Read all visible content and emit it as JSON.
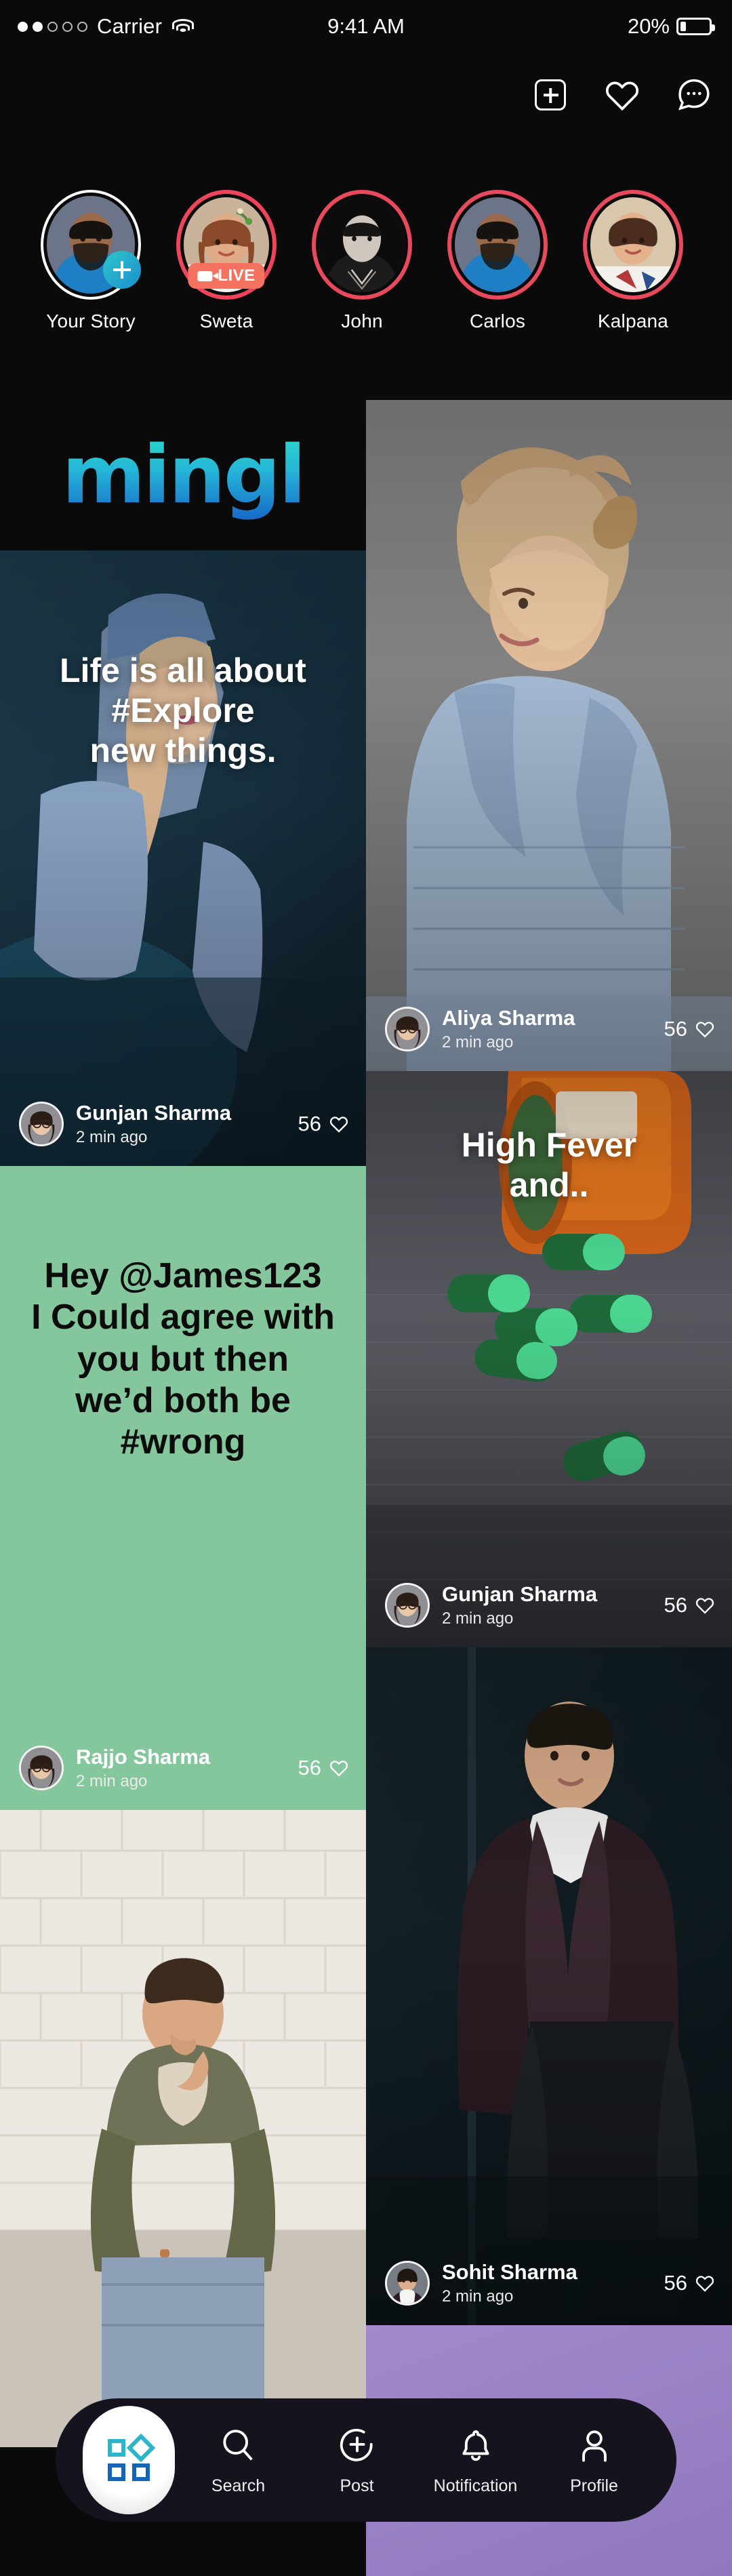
{
  "status_bar": {
    "carrier": "Carrier",
    "signal_dots_filled": 2,
    "signal_dots_total": 5,
    "wifi_icon": "wifi-icon",
    "time": "9:41 AM",
    "battery_percent": "20%",
    "battery_level": 20
  },
  "header": {
    "actions": [
      {
        "name": "add-post-button",
        "icon": "plus-box-icon",
        "label": ""
      },
      {
        "name": "activity-button",
        "icon": "heart-icon",
        "label": ""
      },
      {
        "name": "messages-button",
        "icon": "chat-bubble-dots-icon",
        "label": ""
      }
    ]
  },
  "brand": {
    "logo_text": "mingl",
    "gradient_from": "#2ae0c8",
    "gradient_to": "#1767c8"
  },
  "stories": {
    "items": [
      {
        "label": "Your Story",
        "ring": "own",
        "badge": "add",
        "live": false
      },
      {
        "label": "Sweta",
        "ring": "live",
        "badge": "live",
        "live": true,
        "live_label": "LIVE"
      },
      {
        "label": "John",
        "ring": "seen",
        "badge": "none",
        "live": false
      },
      {
        "label": "Carlos",
        "ring": "seen",
        "badge": "none",
        "live": false
      },
      {
        "label": "Kalpana",
        "ring": "seen",
        "badge": "none",
        "live": false
      }
    ]
  },
  "feed": {
    "posts": [
      {
        "id": "post-explore",
        "column": "left",
        "caption": "Life is all about\n#Explore\nnew things.",
        "caption_color": "light",
        "author": "Gunjan Sharma",
        "time": "2 min ago",
        "likes": "56",
        "theme": "photo-denim-blue"
      },
      {
        "id": "post-aliya",
        "column": "right",
        "caption": "",
        "caption_color": "light",
        "author": "Aliya Sharma",
        "time": "2 min ago",
        "likes": "56",
        "theme": "photo-grey-portrait"
      },
      {
        "id": "post-wrong",
        "column": "left",
        "caption": "Hey @James123\nI Could agree with\nyou but then\nwe’d both be\n#wrong",
        "caption_color": "dark",
        "author": "Rajjo Sharma",
        "time": "2 min ago",
        "likes": "56",
        "theme": "solid-green",
        "background_color": "#84C79C"
      },
      {
        "id": "post-fever",
        "column": "right",
        "caption": "High Fever\nand..",
        "caption_color": "light",
        "author": "Gunjan Sharma",
        "time": "2 min ago",
        "likes": "56",
        "theme": "photo-pills"
      },
      {
        "id": "post-thinker",
        "column": "left",
        "caption": "",
        "caption_color": "light",
        "author": "",
        "time": "",
        "likes": "",
        "theme": "photo-brick-man"
      },
      {
        "id": "post-sohit",
        "column": "right",
        "caption": "",
        "caption_color": "light",
        "author": "Sohit Sharma",
        "time": "2 min ago",
        "likes": "56",
        "theme": "photo-dark-suit"
      },
      {
        "id": "post-orange",
        "column": "left",
        "caption": "",
        "author": "",
        "time": "",
        "likes": "",
        "theme": "solid-orange",
        "background_color": "#F0BC80"
      },
      {
        "id": "post-purple",
        "column": "right",
        "caption": "",
        "author": "",
        "time": "",
        "likes": "",
        "theme": "solid-purple",
        "background_color": "#9B80C4"
      }
    ]
  },
  "bottom_nav": {
    "items": [
      {
        "name": "nav-home",
        "label": "",
        "icon": "grid-icon",
        "active": true
      },
      {
        "name": "nav-search",
        "label": "Search",
        "icon": "search-icon",
        "active": false
      },
      {
        "name": "nav-post",
        "label": "Post",
        "icon": "plus-circle-icon",
        "active": false
      },
      {
        "name": "nav-notification",
        "label": "Notification",
        "icon": "bell-icon",
        "active": false
      },
      {
        "name": "nav-profile",
        "label": "Profile",
        "icon": "person-icon",
        "active": false
      }
    ]
  }
}
